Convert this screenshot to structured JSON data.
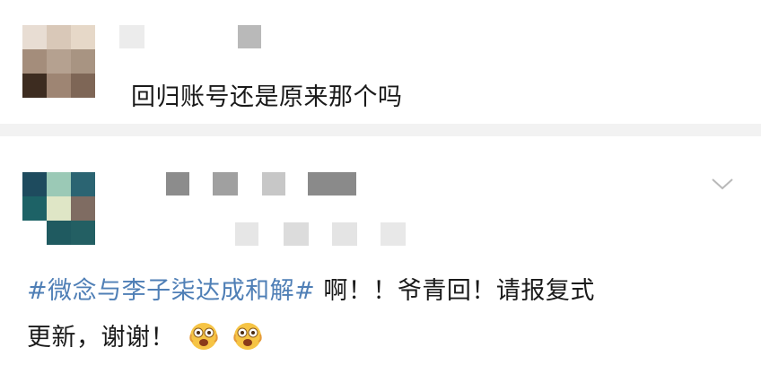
{
  "comments": [
    {
      "text": "回归账号还是原来那个吗"
    },
    {
      "hashtag": "#微念与李子柒达成和解#",
      "text_line1": " 啊！！爷青回！请报复式",
      "text_line2": "更新，谢谢！",
      "emojis": [
        "astonished-face-emoji",
        "astonished-face-emoji"
      ]
    }
  ],
  "colors": {
    "hashtag": "#4f7fb6",
    "text": "#1a1a1a",
    "background": "#f2f2f2",
    "card": "#ffffff"
  },
  "icons": {
    "more": "chevron-down-icon"
  }
}
